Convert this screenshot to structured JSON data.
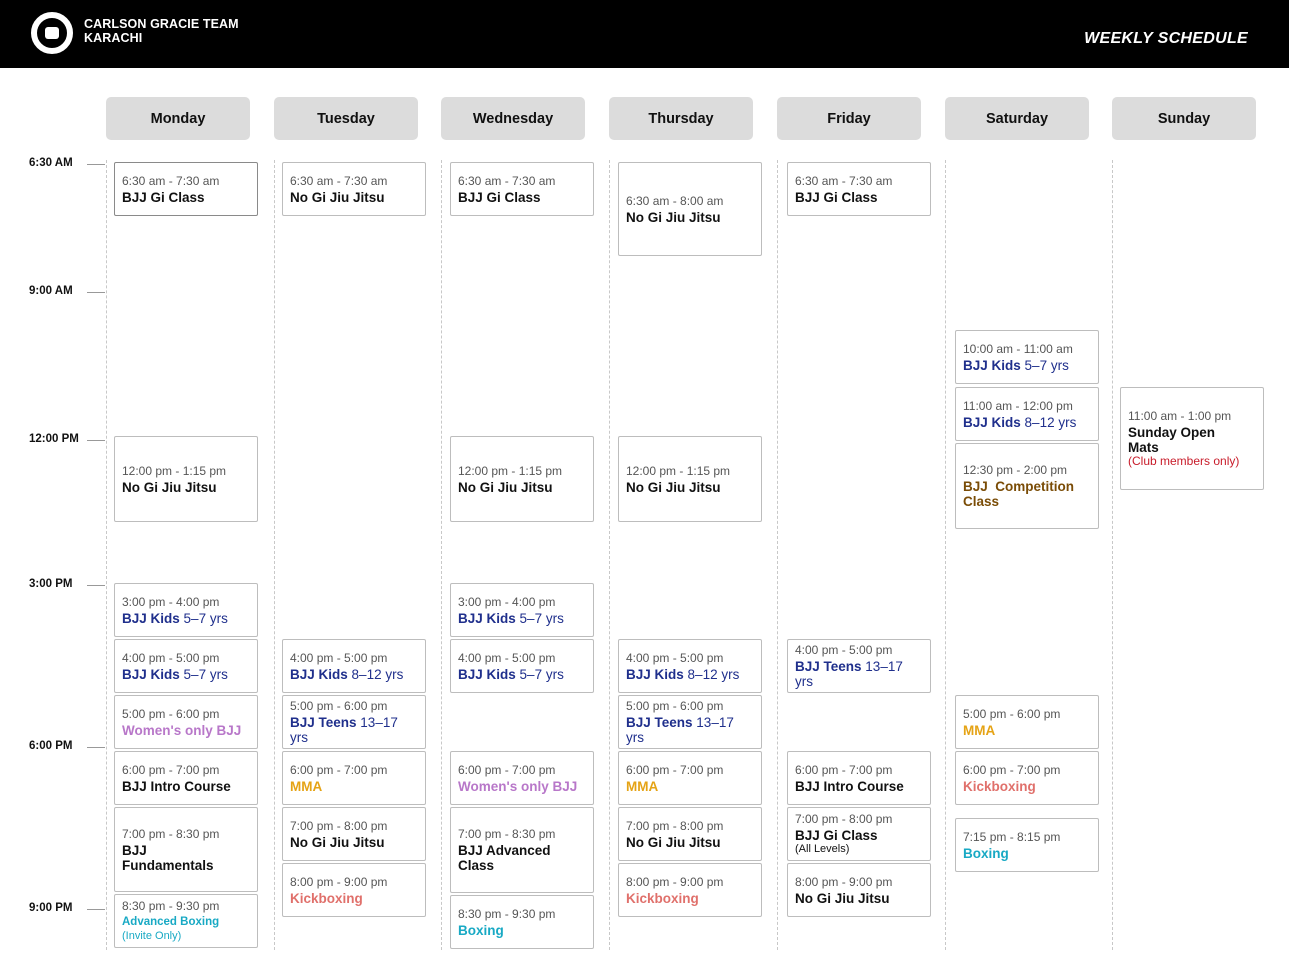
{
  "header": {
    "brand_line1": "CARLSON GRACIE TEAM",
    "brand_line2": "KARACHI",
    "title": "WEEKLY SCHEDULE"
  },
  "days": [
    "Monday",
    "Tuesday",
    "Wednesday",
    "Thursday",
    "Friday",
    "Saturday",
    "Sunday"
  ],
  "times": [
    "6:30 AM",
    "9:00 AM",
    "12:00 PM",
    "3:00 PM",
    "6:00 PM",
    "9:00 PM"
  ],
  "colors": {
    "black": "#111111",
    "navy": "#1f2f8c",
    "purple": "#b877c9",
    "orange": "#e5a315",
    "pink": "#e0706b",
    "teal": "#18a9c4",
    "brown": "#7a4c06",
    "red": "#c81c2a"
  },
  "slots": {
    "monday": [
      {
        "time": "6:30 am - 7:30 am",
        "name": "BJJ Gi Class"
      },
      {
        "time": "12:00 pm - 1:15 pm",
        "name": "No Gi Jiu Jitsu"
      },
      {
        "time": "3:00 pm - 4:00 pm",
        "name": "BJJ Kids",
        "age": "5–7 yrs"
      },
      {
        "time": "4:00 pm - 5:00 pm",
        "name": "BJJ Kids",
        "age": "5–7 yrs"
      },
      {
        "time": "5:00 pm - 6:00 pm",
        "name": "Women's only BJJ"
      },
      {
        "time": "6:00 pm - 7:00 pm",
        "name": "BJJ Intro Course"
      },
      {
        "time": "7:00 pm - 8:30 pm",
        "name_line1": "BJJ",
        "name_line2": "Fundamentals"
      },
      {
        "time": "8:30 pm - 9:30 pm",
        "name": "Advanced Boxing",
        "note": "(Invite Only)"
      }
    ],
    "tuesday": [
      {
        "time": "6:30 am - 7:30 am",
        "name": "No Gi Jiu Jitsu"
      },
      {
        "time": "4:00 pm - 5:00 pm",
        "name": "BJJ Kids",
        "age": "8–12 yrs"
      },
      {
        "time": "5:00 pm - 6:00 pm",
        "name": "BJJ Teens",
        "age": "13–17 yrs"
      },
      {
        "time": "6:00 pm - 7:00 pm",
        "name": "MMA"
      },
      {
        "time": "7:00 pm - 8:00 pm",
        "name": "No Gi Jiu Jitsu"
      },
      {
        "time": "8:00 pm - 9:00 pm",
        "name": "Kickboxing"
      }
    ],
    "wednesday": [
      {
        "time": "6:30 am - 7:30 am",
        "name": "BJJ Gi Class"
      },
      {
        "time": "12:00 pm - 1:15 pm",
        "name": "No Gi Jiu Jitsu"
      },
      {
        "time": "3:00 pm - 4:00 pm",
        "name": "BJJ Kids",
        "age": "5–7 yrs"
      },
      {
        "time": "4:00 pm - 5:00 pm",
        "name": "BJJ Kids",
        "age": "5–7 yrs"
      },
      {
        "time": "6:00 pm - 7:00 pm",
        "name": "Women's only BJJ"
      },
      {
        "time": "7:00 pm - 8:30 pm",
        "name_line1": "BJJ Advanced",
        "name_line2": "Class"
      },
      {
        "time": "8:30 pm - 9:30 pm",
        "name": "Boxing"
      }
    ],
    "thursday": [
      {
        "time": "6:30 am - 8:00 am",
        "name": "No Gi Jiu Jitsu"
      },
      {
        "time": "12:00 pm - 1:15 pm",
        "name": "No Gi Jiu Jitsu"
      },
      {
        "time": "4:00 pm - 5:00 pm",
        "name": "BJJ Kids",
        "age": "8–12 yrs"
      },
      {
        "time": "5:00 pm - 6:00 pm",
        "name": "BJJ Teens",
        "age": "13–17 yrs"
      },
      {
        "time": "6:00 pm - 7:00 pm",
        "name": "MMA"
      },
      {
        "time": "7:00 pm - 8:00 pm",
        "name": "No Gi Jiu Jitsu"
      },
      {
        "time": "8:00 pm - 9:00 pm",
        "name": "Kickboxing"
      }
    ],
    "friday": [
      {
        "time": "6:30 am - 7:30 am",
        "name": "BJJ Gi Class"
      },
      {
        "time": "4:00 pm - 5:00 pm",
        "name": "BJJ Teens",
        "age": "13–17 yrs"
      },
      {
        "time": "6:00 pm - 7:00 pm",
        "name": "BJJ Intro Course"
      },
      {
        "time": "7:00 pm - 8:00 pm",
        "name": "BJJ Gi Class",
        "note": "(All Levels)"
      },
      {
        "time": "8:00 pm - 9:00 pm",
        "name": "No Gi Jiu Jitsu"
      }
    ],
    "saturday": [
      {
        "time": "10:00 am - 11:00 am",
        "name": "BJJ Kids",
        "age": "5–7 yrs"
      },
      {
        "time": "11:00 am - 12:00 pm",
        "name": "BJJ Kids",
        "age": "8–12 yrs"
      },
      {
        "time": "12:30 pm - 2:00 pm",
        "name_line1": "BJJ  Competition",
        "name_line2": "Class"
      },
      {
        "time": "5:00 pm - 6:00 pm",
        "name": "MMA"
      },
      {
        "time": "6:00 pm - 7:00 pm",
        "name": "Kickboxing"
      },
      {
        "time": "7:15 pm - 8:15 pm",
        "name": "Boxing"
      }
    ],
    "sunday": [
      {
        "time": "11:00 am - 1:00 pm",
        "name_line1": "Sunday Open",
        "name_line2": "Mats",
        "note": "(Club members only)"
      }
    ]
  }
}
